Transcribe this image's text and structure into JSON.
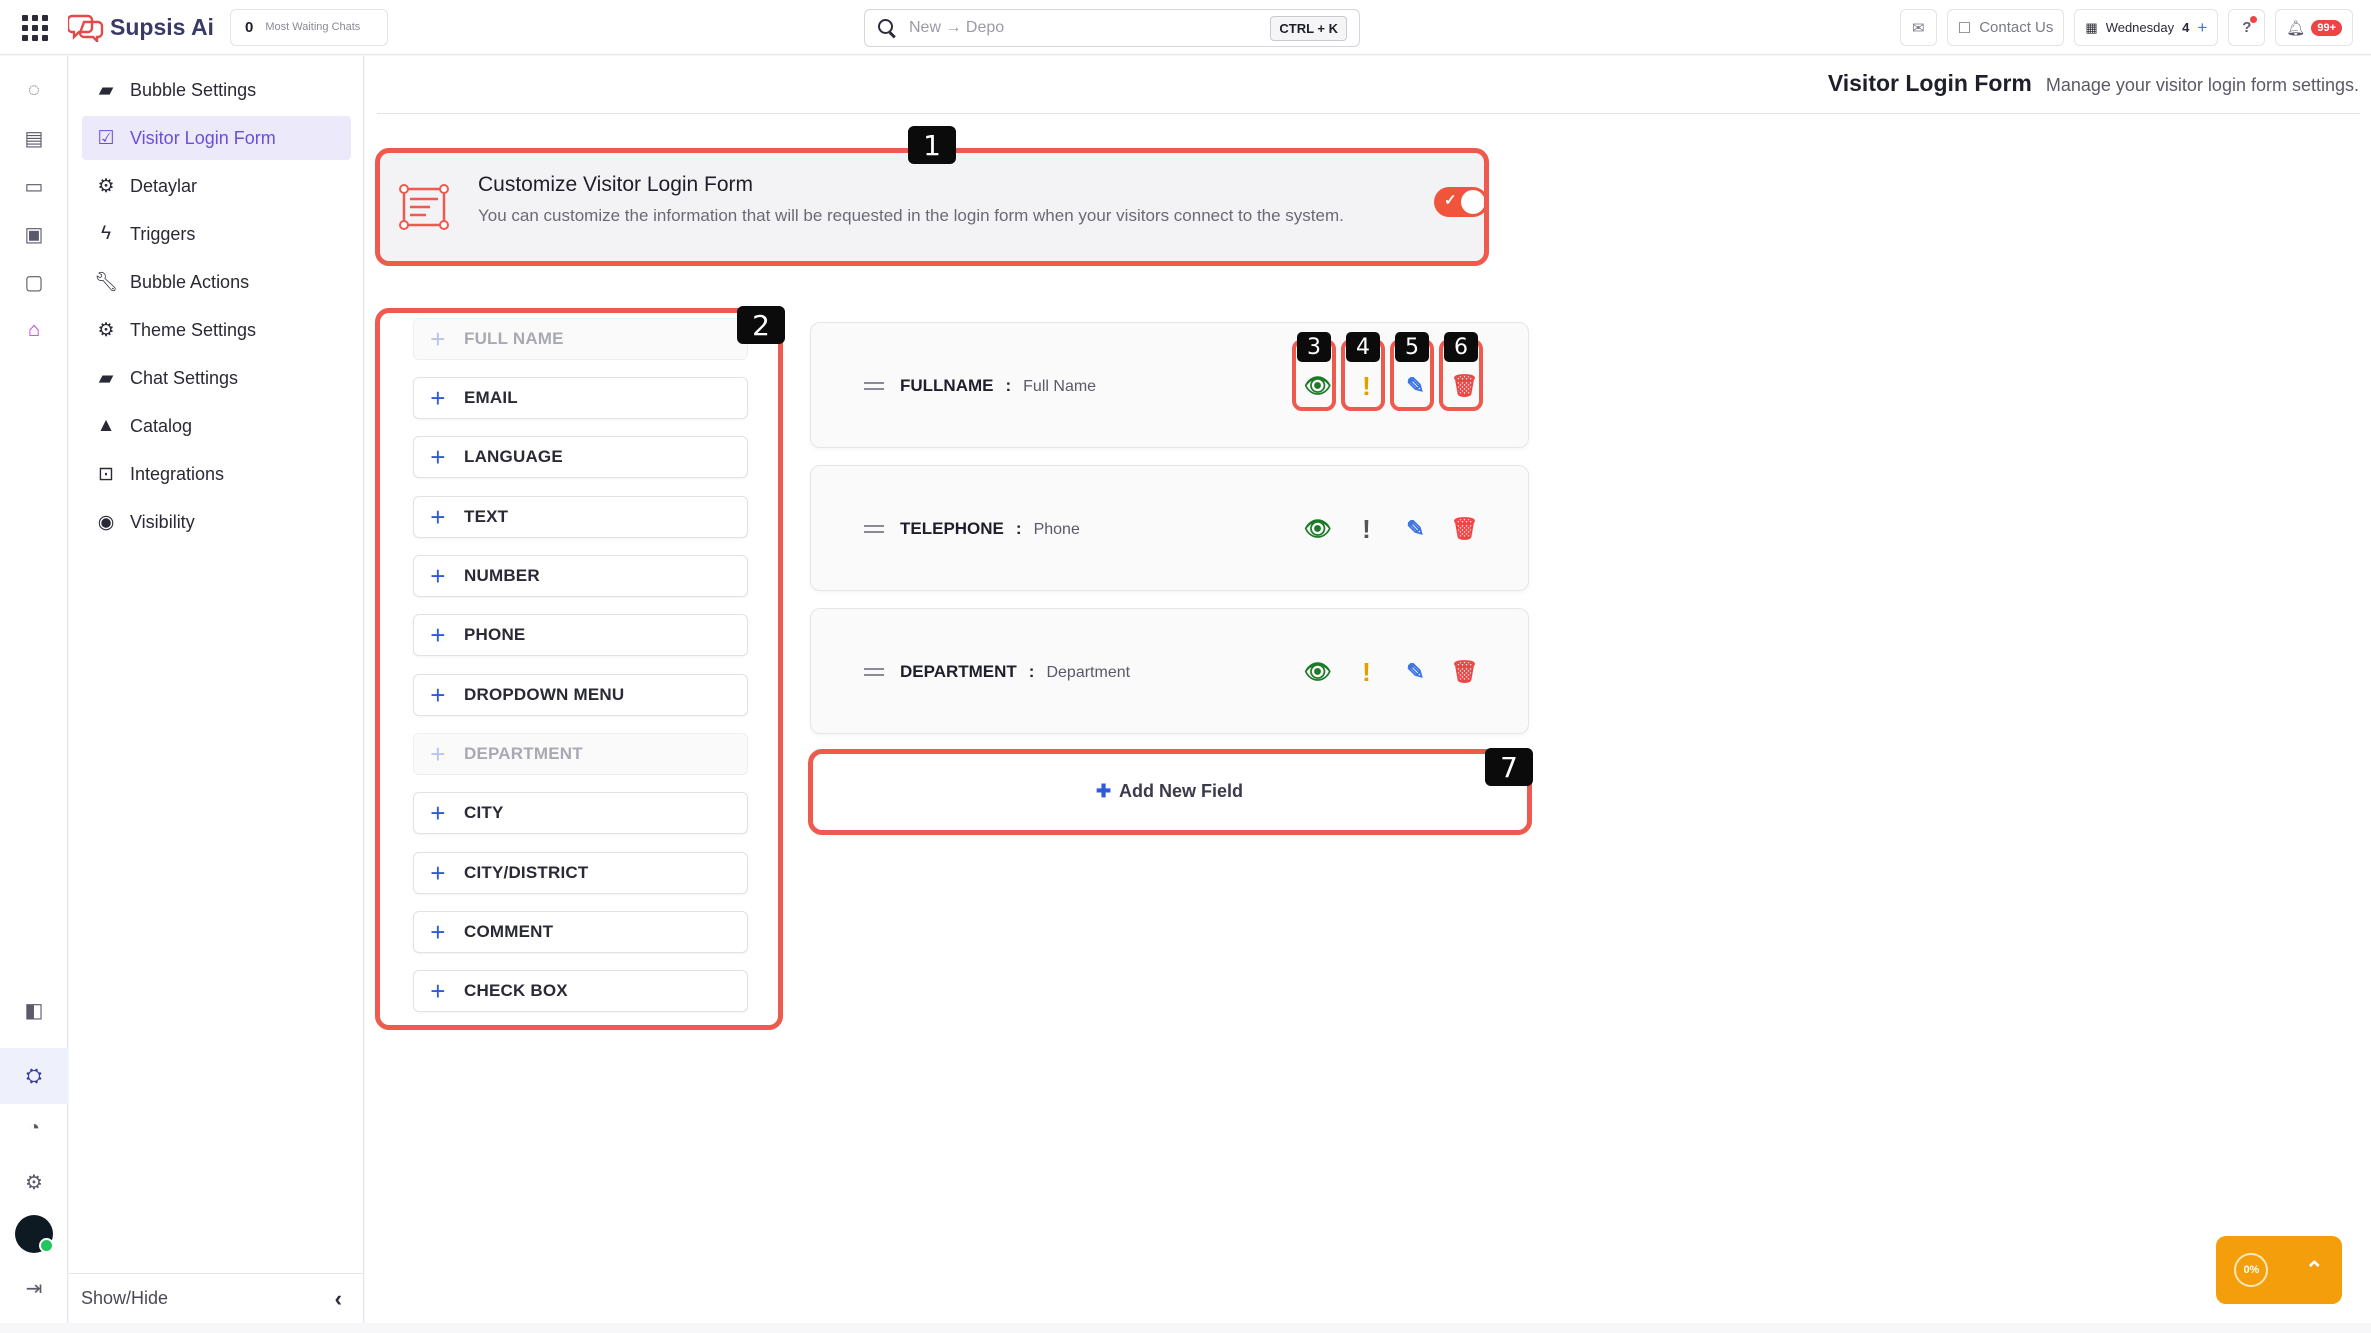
{
  "topbar": {
    "app_name": "Supsis Ai",
    "waiting_count": "0",
    "waiting_label": "Most Waiting Chats",
    "search_value": "New → Depo",
    "search_shortcut": "CTRL + K",
    "contact_label": "Contact Us",
    "date_label": "Wednesday",
    "date_num": "4",
    "notif_badge": "99+"
  },
  "settings_nav": {
    "items": [
      {
        "label": "Bubble Settings",
        "icon": "chat-square-icon"
      },
      {
        "label": "Visitor Login Form",
        "icon": "checkbox-icon",
        "active": true
      },
      {
        "label": "Detaylar",
        "icon": "gear-icon"
      },
      {
        "label": "Triggers",
        "icon": "bolt-icon"
      },
      {
        "label": "Bubble Actions",
        "icon": "wrench-icon"
      },
      {
        "label": "Theme Settings",
        "icon": "gear-icon"
      },
      {
        "label": "Chat Settings",
        "icon": "chat-square-icon"
      },
      {
        "label": "Catalog",
        "icon": "shapes-icon"
      },
      {
        "label": "Integrations",
        "icon": "integration-icon"
      },
      {
        "label": "Visibility",
        "icon": "eye-icon"
      }
    ],
    "footer_label": "Show/Hide"
  },
  "page": {
    "title": "Visitor Login Form",
    "subtitle": "Manage your visitor login form settings."
  },
  "customize_card": {
    "title": "Customize Visitor Login Form",
    "description": "You can customize the information that will be requested in the login form when your visitors connect to the system.",
    "enabled": true
  },
  "field_palette": [
    {
      "label": "FULL NAME",
      "disabled": true
    },
    {
      "label": "EMAIL",
      "disabled": false
    },
    {
      "label": "LANGUAGE",
      "disabled": false
    },
    {
      "label": "TEXT",
      "disabled": false
    },
    {
      "label": "NUMBER",
      "disabled": false
    },
    {
      "label": "PHONE",
      "disabled": false
    },
    {
      "label": "DROPDOWN MENU",
      "disabled": false
    },
    {
      "label": "DEPARTMENT",
      "disabled": true
    },
    {
      "label": "CITY",
      "disabled": false
    },
    {
      "label": "CITY/DISTRICT",
      "disabled": false
    },
    {
      "label": "COMMENT",
      "disabled": false
    },
    {
      "label": "CHECK BOX",
      "disabled": false
    }
  ],
  "form_fields": [
    {
      "key": "FULLNAME",
      "sep": ":",
      "value": "Full Name",
      "required": false
    },
    {
      "key": "TELEPHONE",
      "sep": ":",
      "value": "Phone",
      "required": true
    },
    {
      "key": "DEPARTMENT",
      "sep": ":",
      "value": "Department",
      "required": false
    }
  ],
  "add_field_label": "Add New Field",
  "callouts": [
    "1",
    "2",
    "3",
    "4",
    "5",
    "6",
    "7"
  ],
  "fab_progress": "0%",
  "colors": {
    "accent": "#6b4fd8",
    "callout": "#ef5a4f",
    "toggle": "#f0553b",
    "eye": "#1d7a26",
    "warn": "#e0a100",
    "edit": "#3b73e0",
    "delete": "#ef4444",
    "fab": "#f59e0b"
  }
}
